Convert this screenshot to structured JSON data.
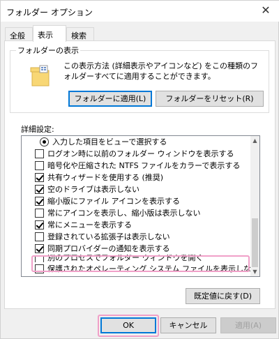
{
  "window": {
    "title": "フォルダー オプション",
    "close_glyph": "✕"
  },
  "tabs": [
    {
      "label": "全般"
    },
    {
      "label": "表示"
    },
    {
      "label": "検索"
    }
  ],
  "folder_view": {
    "label": "フォルダーの表示",
    "description": "この表示方法 (詳細表示やアイコンなど) をこの種類のフォルダーすべてに適用することができます。",
    "apply_button": "フォルダーに適用(L)",
    "reset_button": "フォルダーをリセット(R)"
  },
  "advanced": {
    "label": "詳細設定:",
    "items": [
      {
        "type": "radio",
        "checked": true,
        "label": "入力した項目をビューで選択する"
      },
      {
        "type": "check",
        "checked": false,
        "label": "ログオン時に以前のフォルダー ウィンドウを表示する"
      },
      {
        "type": "check",
        "checked": false,
        "label": "暗号化や圧縮された NTFS ファイルをカラーで表示する"
      },
      {
        "type": "check",
        "checked": true,
        "label": "共有ウィザードを使用する (推奨)"
      },
      {
        "type": "check",
        "checked": true,
        "label": "空のドライブは表示しない"
      },
      {
        "type": "check",
        "checked": true,
        "label": "縮小版にファイル アイコンを表示する"
      },
      {
        "type": "check",
        "checked": false,
        "label": "常にアイコンを表示し、縮小版は表示しない"
      },
      {
        "type": "check",
        "checked": true,
        "label": "常にメニューを表示する"
      },
      {
        "type": "check",
        "checked": false,
        "label": "登録されている拡張子は表示しない"
      },
      {
        "type": "check",
        "checked": true,
        "label": "同期プロバイダーの通知を表示する"
      },
      {
        "type": "check",
        "checked": false,
        "label": "別のプロセスでフォルダー ウィンドウを開く"
      },
      {
        "type": "check",
        "checked": false,
        "label": "保護されたオペレーティング システム ファイルを表示しない (推奨)"
      }
    ],
    "restore_button": "既定値に戻す(D)"
  },
  "footer": {
    "ok": "OK",
    "cancel": "キャンセル",
    "apply": "適用(A)"
  },
  "colors": {
    "highlight": "#f0a0c8",
    "focus": "#0078d7"
  }
}
